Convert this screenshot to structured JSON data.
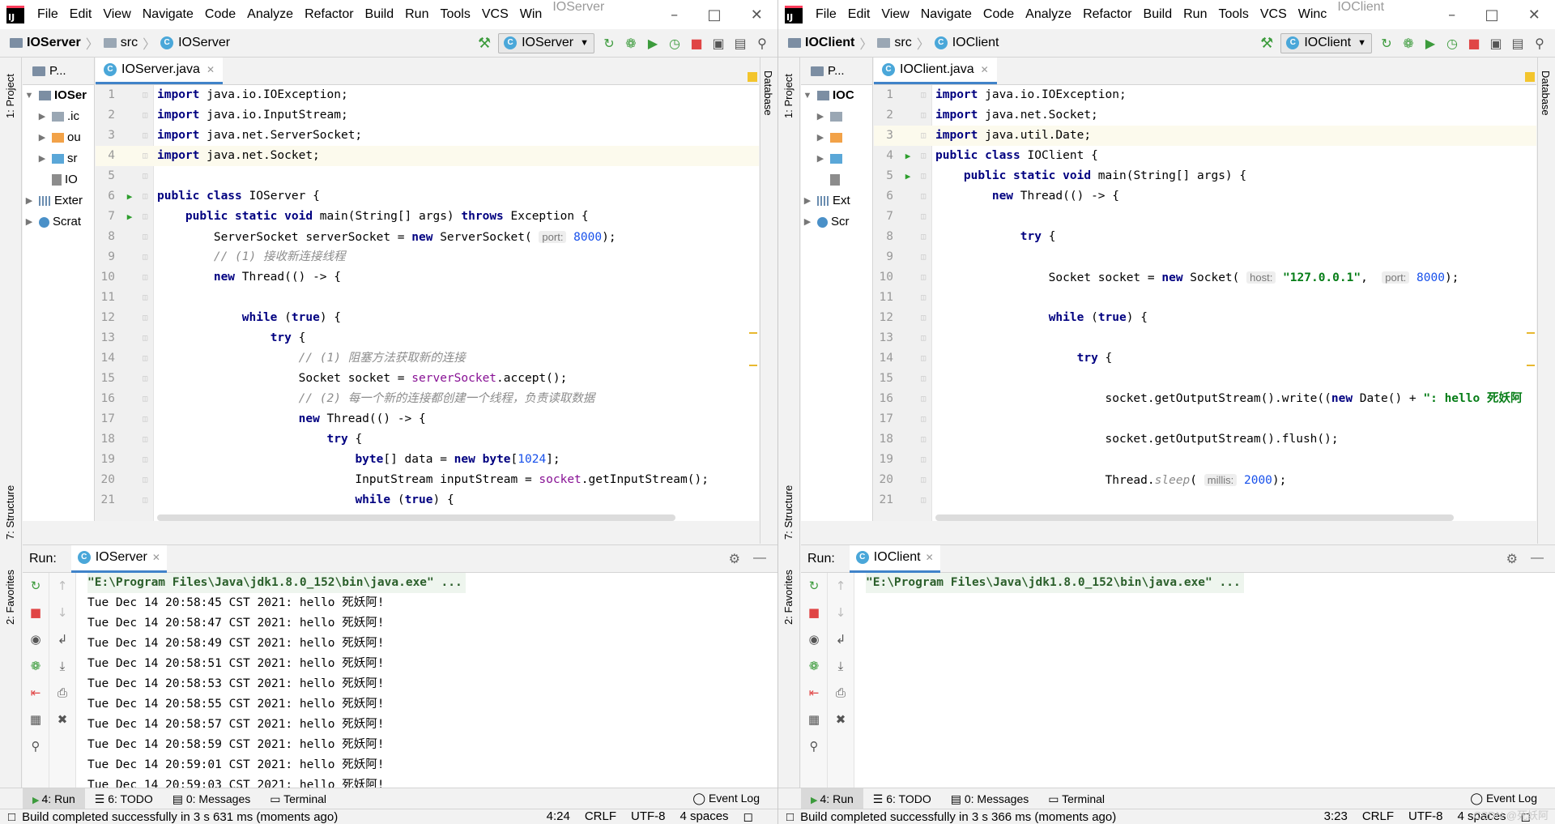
{
  "menu": [
    "File",
    "Edit",
    "View",
    "Navigate",
    "Code",
    "Analyze",
    "Refactor",
    "Build",
    "Run",
    "Tools",
    "VCS"
  ],
  "windows": [
    {
      "menu_last": "Win",
      "title_suffix": "IOServer",
      "breadcrumb": {
        "project": "IOServer",
        "folder": "src",
        "file": "IOServer"
      },
      "run_config": "IOServer",
      "project_tab": "P...",
      "tree": [
        ".ic",
        "ou",
        "sr",
        "IO",
        "Exter",
        "Scrat"
      ],
      "tree_root": "IOSer",
      "editor_tab": "IOServer.java",
      "run_tab": "IOServer",
      "cmd": "\"E:\\Program Files\\Java\\jdk1.8.0_152\\bin\\java.exe\" ...",
      "console": [
        "Tue Dec 14 20:58:45 CST 2021: hello 死妖阿!",
        "Tue Dec 14 20:58:47 CST 2021: hello 死妖阿!",
        "Tue Dec 14 20:58:49 CST 2021: hello 死妖阿!",
        "Tue Dec 14 20:58:51 CST 2021: hello 死妖阿!",
        "Tue Dec 14 20:58:53 CST 2021: hello 死妖阿!",
        "Tue Dec 14 20:58:55 CST 2021: hello 死妖阿!",
        "Tue Dec 14 20:58:57 CST 2021: hello 死妖阿!",
        "Tue Dec 14 20:58:59 CST 2021: hello 死妖阿!",
        "Tue Dec 14 20:59:01 CST 2021: hello 死妖阿!",
        "Tue Dec 14 20:59:03 CST 2021: hello 死妖阿!"
      ],
      "status": "Build completed successfully in 3 s 631 ms (moments ago)",
      "status_right": {
        "pos": "4:24",
        "eol": "CRLF",
        "enc": "UTF-8",
        "indent": "4 spaces"
      },
      "code": [
        {
          "n": "1",
          "t": [
            [
              "kw",
              "import"
            ],
            [
              "",
              "java.io.IOException;"
            ]
          ]
        },
        {
          "n": "2",
          "t": [
            [
              "kw",
              "import"
            ],
            [
              "",
              "java.io.InputStream;"
            ]
          ]
        },
        {
          "n": "3",
          "t": [
            [
              "kw",
              "import"
            ],
            [
              "",
              "java.net.ServerSocket;"
            ]
          ]
        },
        {
          "n": "4",
          "hl": true,
          "t": [
            [
              "kw",
              "import"
            ],
            [
              "",
              "java.net.Socket;"
            ]
          ]
        },
        {
          "n": "5",
          "t": []
        },
        {
          "n": "6",
          "run": true,
          "t": [
            [
              "kw",
              "public class"
            ],
            [
              "",
              "IOServer {"
            ]
          ]
        },
        {
          "n": "7",
          "run": true,
          "t": [
            [
              "",
              "    "
            ],
            [
              "kw",
              "public static void"
            ],
            [
              "",
              "main(String[] args) "
            ],
            [
              "kw",
              "throws"
            ],
            [
              "",
              "Exception {"
            ]
          ]
        },
        {
          "n": "8",
          "t": [
            [
              "",
              "        ServerSocket serverSocket = "
            ],
            [
              "kw",
              "new"
            ],
            [
              "",
              "ServerSocket( "
            ],
            [
              "hint",
              "port:"
            ],
            [
              "num",
              " 8000"
            ],
            [
              "",
              ");"
            ]
          ]
        },
        {
          "n": "9",
          "t": [
            [
              "",
              "        "
            ],
            [
              "cm",
              "// (1) 接收新连接线程"
            ]
          ]
        },
        {
          "n": "10",
          "t": [
            [
              "",
              "        "
            ],
            [
              "kw",
              "new"
            ],
            [
              "",
              "Thread(() -> {"
            ]
          ]
        },
        {
          "n": "11",
          "t": []
        },
        {
          "n": "12",
          "t": [
            [
              "",
              "            "
            ],
            [
              "kw",
              "while"
            ],
            [
              "",
              " ("
            ],
            [
              "kw",
              "true"
            ],
            [
              "",
              ") {"
            ]
          ]
        },
        {
          "n": "13",
          "t": [
            [
              "",
              "                "
            ],
            [
              "kw",
              "try"
            ],
            [
              "",
              " {"
            ]
          ]
        },
        {
          "n": "14",
          "t": [
            [
              "",
              "                    "
            ],
            [
              "cm",
              "// (1) 阻塞方法获取新的连接"
            ]
          ]
        },
        {
          "n": "15",
          "t": [
            [
              "",
              "                    Socket socket = "
            ],
            [
              "fld",
              "serverSocket"
            ],
            [
              "",
              ".accept();"
            ]
          ]
        },
        {
          "n": "16",
          "t": [
            [
              "",
              "                    "
            ],
            [
              "cm",
              "// (2) 每一个新的连接都创建一个线程，负责读取数据"
            ]
          ]
        },
        {
          "n": "17",
          "t": [
            [
              "",
              "                    "
            ],
            [
              "kw",
              "new"
            ],
            [
              "",
              "Thread(() -> {"
            ]
          ]
        },
        {
          "n": "18",
          "t": [
            [
              "",
              "                        "
            ],
            [
              "kw",
              "try"
            ],
            [
              "",
              " {"
            ]
          ]
        },
        {
          "n": "19",
          "t": [
            [
              "",
              "                            "
            ],
            [
              "kw",
              "byte"
            ],
            [
              "",
              "[] data = "
            ],
            [
              "kw",
              "new"
            ],
            [
              "",
              " "
            ],
            [
              "kw",
              "byte"
            ],
            [
              "",
              "["
            ],
            [
              "num",
              "1024"
            ],
            [
              "",
              "];"
            ]
          ]
        },
        {
          "n": "20",
          "t": [
            [
              "",
              "                            InputStream inputStream = "
            ],
            [
              "fld",
              "socket"
            ],
            [
              "",
              ".getInputStream();"
            ]
          ]
        },
        {
          "n": "21",
          "t": [
            [
              "",
              "                            "
            ],
            [
              "kw",
              "while"
            ],
            [
              "",
              " ("
            ],
            [
              "kw",
              "true"
            ],
            [
              "",
              ") {"
            ]
          ]
        }
      ]
    },
    {
      "menu_last": "Winc",
      "title_suffix": "IOClient",
      "breadcrumb": {
        "project": "IOClient",
        "folder": "src",
        "file": "IOClient"
      },
      "run_config": "IOClient",
      "project_tab": "P...",
      "tree": [
        "",
        "",
        "",
        "",
        "Ext",
        "Scr"
      ],
      "tree_root": "IOC",
      "editor_tab": "IOClient.java",
      "run_tab": "IOClient",
      "cmd": "\"E:\\Program Files\\Java\\jdk1.8.0_152\\bin\\java.exe\" ...",
      "console": [],
      "status": "Build completed successfully in 3 s 366 ms (moments ago)",
      "status_right": {
        "pos": "3:23",
        "eol": "CRLF",
        "enc": "UTF-8",
        "indent": "4 spaces"
      },
      "code": [
        {
          "n": "1",
          "t": [
            [
              "kw",
              "import"
            ],
            [
              "",
              "java.io.IOException;"
            ]
          ]
        },
        {
          "n": "2",
          "t": [
            [
              "kw",
              "import"
            ],
            [
              "",
              "java.net.Socket;"
            ]
          ]
        },
        {
          "n": "3",
          "hl": true,
          "t": [
            [
              "kw",
              "import"
            ],
            [
              "",
              "java.util.Date;"
            ]
          ]
        },
        {
          "n": "4",
          "run": true,
          "t": [
            [
              "kw",
              "public class"
            ],
            [
              "",
              "IOClient {"
            ]
          ]
        },
        {
          "n": "5",
          "run": true,
          "t": [
            [
              "",
              "    "
            ],
            [
              "kw",
              "public static void"
            ],
            [
              "",
              "main(String[] args) {"
            ]
          ]
        },
        {
          "n": "6",
          "t": [
            [
              "",
              "        "
            ],
            [
              "kw",
              "new"
            ],
            [
              "",
              "Thread(() -> {"
            ]
          ]
        },
        {
          "n": "7",
          "t": []
        },
        {
          "n": "8",
          "t": [
            [
              "",
              "            "
            ],
            [
              "kw",
              "try"
            ],
            [
              "",
              " {"
            ]
          ]
        },
        {
          "n": "9",
          "t": []
        },
        {
          "n": "10",
          "t": [
            [
              "",
              "                Socket socket = "
            ],
            [
              "kw",
              "new"
            ],
            [
              "",
              "Socket( "
            ],
            [
              "hint",
              "host:"
            ],
            [
              "",
              " "
            ],
            [
              "st",
              "\"127.0.0.1\""
            ],
            [
              "",
              ",  "
            ],
            [
              "hint",
              "port:"
            ],
            [
              "num",
              " 8000"
            ],
            [
              "",
              ");"
            ]
          ]
        },
        {
          "n": "11",
          "t": []
        },
        {
          "n": "12",
          "t": [
            [
              "",
              "                "
            ],
            [
              "kw",
              "while"
            ],
            [
              "",
              " ("
            ],
            [
              "kw",
              "true"
            ],
            [
              "",
              ") {"
            ]
          ]
        },
        {
          "n": "13",
          "t": []
        },
        {
          "n": "14",
          "t": [
            [
              "",
              "                    "
            ],
            [
              "kw",
              "try"
            ],
            [
              "",
              " {"
            ]
          ]
        },
        {
          "n": "15",
          "t": []
        },
        {
          "n": "16",
          "t": [
            [
              "",
              "                        socket.getOutputStream().write(("
            ],
            [
              "kw",
              "new"
            ],
            [
              "",
              " Date() + "
            ],
            [
              "st",
              "\": hello 死妖阿"
            ]
          ]
        },
        {
          "n": "17",
          "t": []
        },
        {
          "n": "18",
          "t": [
            [
              "",
              "                        socket.getOutputStream().flush();"
            ]
          ]
        },
        {
          "n": "19",
          "t": []
        },
        {
          "n": "20",
          "t": [
            [
              "",
              "                        Thread."
            ],
            [
              "cm",
              "sleep"
            ],
            [
              "",
              "( "
            ],
            [
              "hint",
              "millis:"
            ],
            [
              "num",
              " 2000"
            ],
            [
              "",
              ");"
            ]
          ]
        },
        {
          "n": "21",
          "t": []
        }
      ]
    }
  ],
  "left_strip": {
    "project": "1: Project",
    "structure": "7: Structure",
    "favorites": "2: Favorites"
  },
  "right_strip": "Database",
  "run_label": "Run:",
  "bottom_tabs": {
    "run": "4: Run",
    "todo": "6: TODO",
    "messages": "0: Messages",
    "terminal": "Terminal",
    "event_log": "Event Log"
  },
  "watermark": "CSDN @死妖阿"
}
